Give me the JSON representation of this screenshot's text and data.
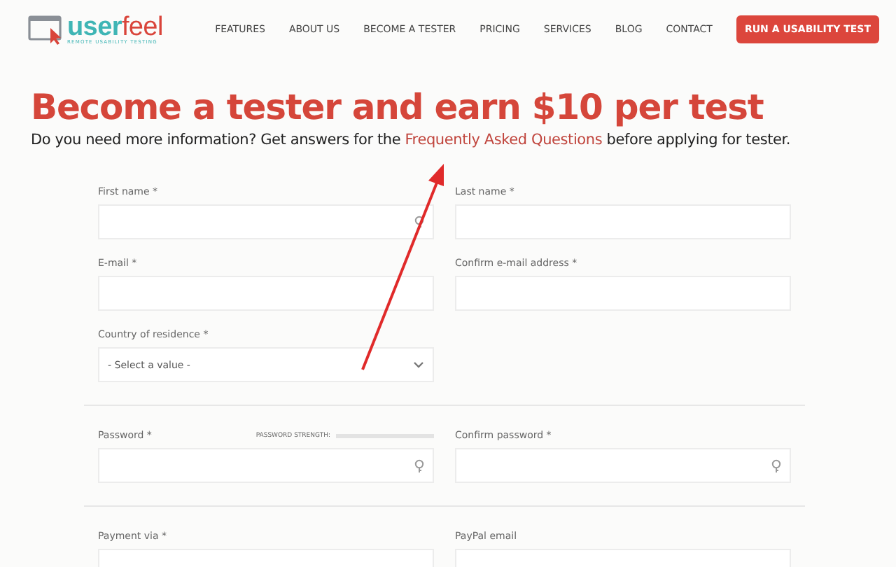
{
  "logo": {
    "name": "user",
    "name_accent": "feel",
    "tagline": "REMOTE USABILITY TESTING"
  },
  "nav": {
    "items": [
      "FEATURES",
      "ABOUT US",
      "BECOME A TESTER",
      "PRICING",
      "SERVICES",
      "BLOG",
      "CONTACT"
    ],
    "cta": "RUN A USABILITY TEST"
  },
  "heading": "Become a tester and earn $10 per test",
  "intro": {
    "before": "Do you need more information? Get answers for the ",
    "link": "Frequently Asked Questions",
    "after": " before applying for tester."
  },
  "sections": [
    {
      "fields": [
        {
          "kind": "text",
          "label": "First name *",
          "key_icon": true
        },
        {
          "kind": "text",
          "label": "Last name *",
          "key_icon": false
        },
        {
          "kind": "text",
          "label": "E-mail *",
          "key_icon": false
        },
        {
          "kind": "text",
          "label": "Confirm e-mail address *",
          "key_icon": false
        },
        {
          "kind": "select",
          "label": "Country of residence *",
          "value": "- Select a value -"
        }
      ]
    },
    {
      "fields": [
        {
          "kind": "password",
          "label": "Password *",
          "strength_label": "PASSWORD STRENGTH:",
          "key_icon": true
        },
        {
          "kind": "text",
          "label": "Confirm password *",
          "key_icon": true
        }
      ]
    },
    {
      "fields": [
        {
          "kind": "text",
          "label": "Payment via *",
          "key_icon": false
        },
        {
          "kind": "text",
          "label": "PayPal email",
          "key_icon": false
        }
      ]
    }
  ]
}
